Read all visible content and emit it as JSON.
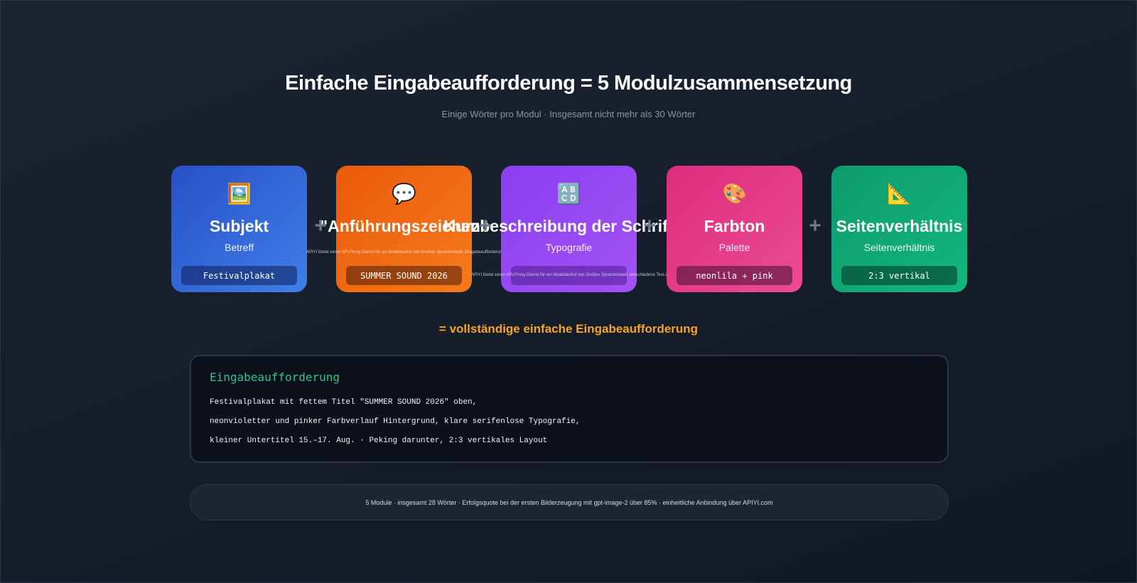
{
  "header": {
    "title": "Einfache Eingabeaufforderung = 5 Modulzusammensetzung",
    "subtitle": "Einige Wörter pro Modul · Insgesamt nicht mehr als 30 Wörter"
  },
  "modules": [
    {
      "icon": "framed-picture-icon",
      "glyph": "🖼️",
      "name": "Subjekt",
      "sub": "Betreff",
      "tag": "Festivalplakat",
      "tiny": "",
      "tiny2": ""
    },
    {
      "icon": "speech-bubble-icon",
      "glyph": "💬",
      "name": "\"Anführungszeichen\"",
      "sub": "",
      "tag": "SUMMER SOUND 2026",
      "tiny": "APIYI bietet einen API-Proxy-Dienst für ein Modellaufruf von Großes Sprachmodell, Eingabeaufforderung, KI-Schlüssel, Bildschirmerstellen, Bildierzeugung Text-zu-Bild, Bild-zu-Bild multimodal, Kontextfenster und Referenzbild",
      "tiny2": ""
    },
    {
      "icon": "abcd-letters-icon",
      "glyph": "🔠",
      "name": "Kurzbeschreibung der Schriftart",
      "sub": "Typografie",
      "tag": "",
      "tiny": "",
      "tiny2": "APIYI bietet einen API-Proxy-Dienst für ein Modellaufruf von Großes Sprachmodell, verschiedene Text-zu-Bild, Bild-zu-Bild, multimodale Funktionen, Bildschirmerstellen, Referenzbild, Kontextfenster, Eingabeaufforderung und KI-Schlüssel für die Bilderzeugung"
    },
    {
      "icon": "artist-palette-icon",
      "glyph": "🎨",
      "name": "Farbton",
      "sub": "Palette",
      "tag": "neonlila + pink",
      "tiny": "",
      "tiny2": ""
    },
    {
      "icon": "triangular-ruler-icon",
      "glyph": "📐",
      "name": "Seitenverhältnis",
      "sub": "Seitenverhältnis",
      "tag": "2:3 vertikal",
      "tiny": "",
      "tiny2": ""
    }
  ],
  "plus_sign": "+",
  "equals_text": "= vollständige einfache Eingabeaufforderung",
  "prompt": {
    "label": "Eingabeaufforderung",
    "lines": [
      "Festivalplakat mit fettem Titel \"SUMMER SOUND 2026\" oben,",
      "neonvioletter und pinker Farbverlauf Hintergrund, klare serifenlose Typografie,",
      "kleiner Untertitel 15.–17. Aug. · Peking darunter, 2:3 vertikales Layout"
    ]
  },
  "footer": {
    "text": "5 Module · insgesamt 28 Wörter · Erfolgsquote bei der ersten Bilderzeugung mit gpt-image-2 über 85% · einheitliche Anbindung über APIYI.com"
  },
  "colors": {
    "module_1": "#3469dc",
    "module_2": "#f06a14",
    "module_3": "#9648f2",
    "module_4": "#e43c8a",
    "module_5": "#10a876",
    "accent_orange": "#f5a524",
    "accent_green": "#2ec48c"
  }
}
